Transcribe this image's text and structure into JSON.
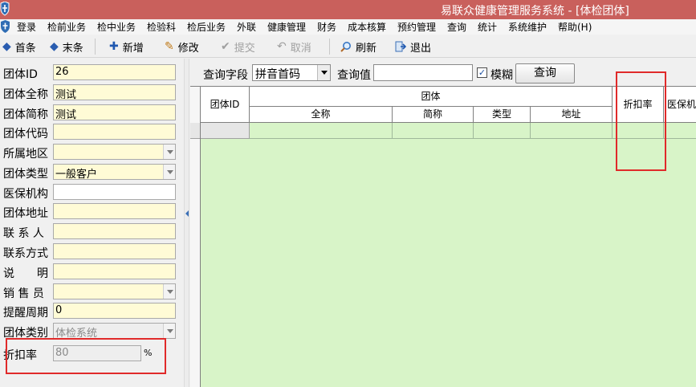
{
  "window": {
    "title": "易联众健康管理服务系统 - [体检团体]"
  },
  "menu": [
    "登录",
    "检前业务",
    "检中业务",
    "检验科",
    "检后业务",
    "外联",
    "健康管理",
    "财务",
    "成本核算",
    "预约管理",
    "查询",
    "统计",
    "系统维护",
    "帮助(H)"
  ],
  "toolbar": {
    "first": "首条",
    "last": "末条",
    "add": "新增",
    "edit": "修改",
    "submit": "提交",
    "cancel": "取消",
    "refresh": "刷新",
    "exit": "退出"
  },
  "form": {
    "fields": [
      {
        "label": "团体ID",
        "value": "26"
      },
      {
        "label": "团体全称",
        "value": "测试"
      },
      {
        "label": "团体简称",
        "value": "测试"
      },
      {
        "label": "团体代码",
        "value": ""
      },
      {
        "label": "所属地区",
        "value": ""
      },
      {
        "label": "团体类型",
        "value": "一般客户"
      },
      {
        "label": "医保机构",
        "value": ""
      },
      {
        "label": "团体地址",
        "value": ""
      },
      {
        "label": "联 系 人",
        "value": ""
      },
      {
        "label": "联系方式",
        "value": ""
      },
      {
        "label": "说　　明",
        "value": ""
      },
      {
        "label": "销 售 员",
        "value": ""
      },
      {
        "label": "提醒周期",
        "value": "0"
      },
      {
        "label": "团体类别",
        "value": "体检系统"
      },
      {
        "label": "折扣率",
        "value": "80"
      }
    ],
    "percent_sign": "%"
  },
  "query": {
    "field_label": "查询字段",
    "field_value": "拼音首码",
    "value_label": "查询值",
    "value": "",
    "fuzzy_label": "模糊",
    "fuzzy_checked": true,
    "button_label": "查询"
  },
  "grid": {
    "columns": {
      "group_id": "团体ID",
      "group_header": "团体",
      "full_name": "全称",
      "short_name": "简称",
      "type": "类型",
      "address": "地址",
      "discount": "折扣率",
      "medical_insurance": "医保机构"
    }
  },
  "colors": {
    "titlebar": "#c9605c",
    "field_background": "#fffbd6",
    "grid_background": "#d8f4c8",
    "highlight_box": "#e02a2a"
  }
}
